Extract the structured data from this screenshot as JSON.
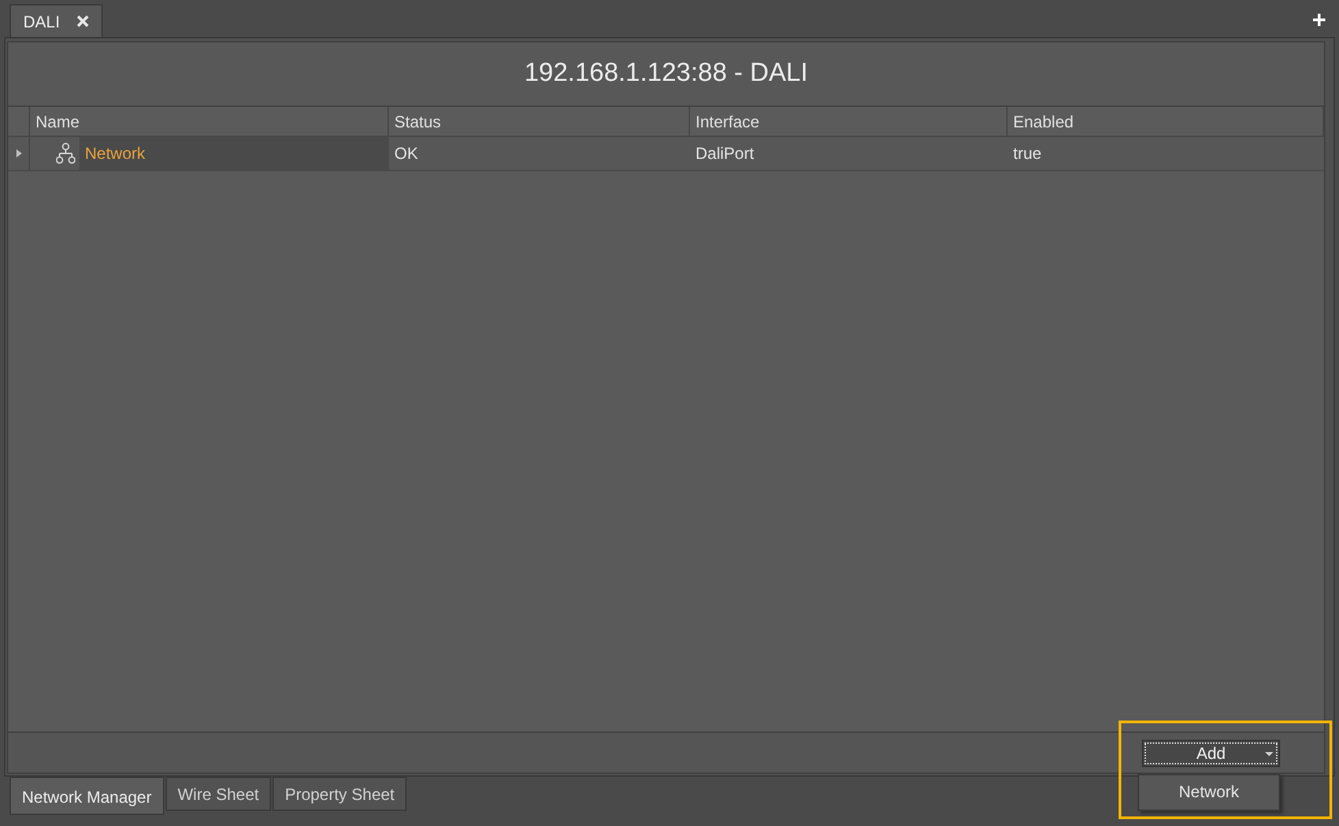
{
  "document_tabs": [
    {
      "label": "DALI",
      "selected": true
    }
  ],
  "header": {
    "title": "192.168.1.123:88 - DALI"
  },
  "table": {
    "columns": [
      "Name",
      "Status",
      "Interface",
      "Enabled"
    ],
    "rows": [
      {
        "expanded": false,
        "selected": true,
        "cells": [
          "Network",
          "OK",
          "DaliPort",
          "true"
        ]
      }
    ]
  },
  "add_button": {
    "label": "Add"
  },
  "dropdown_menu": {
    "items": [
      "Network"
    ]
  },
  "view_tabs": [
    {
      "label": "Network Manager",
      "selected": true
    },
    {
      "label": "Wire Sheet",
      "selected": false
    },
    {
      "label": "Property Sheet",
      "selected": false
    }
  ]
}
